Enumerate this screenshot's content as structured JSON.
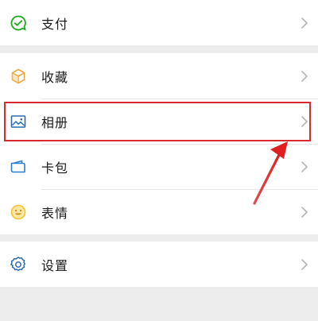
{
  "menu": {
    "pay": {
      "label": "支付",
      "icon": "wechat-pay-icon",
      "color": "#1aad19"
    },
    "favorites": {
      "label": "收藏",
      "icon": "cube-icon",
      "color": "#f2a53c"
    },
    "album": {
      "label": "相册",
      "icon": "image-icon",
      "color": "#2b6cb0"
    },
    "cards": {
      "label": "卡包",
      "icon": "card-wallet-icon",
      "color": "#2b7fd1"
    },
    "stickers": {
      "label": "表情",
      "icon": "smiley-icon",
      "color": "#f2c530"
    },
    "settings": {
      "label": "设置",
      "icon": "gear-icon",
      "color": "#2b6cb0"
    }
  },
  "annotation": {
    "highlight_color": "#d92b2b"
  }
}
